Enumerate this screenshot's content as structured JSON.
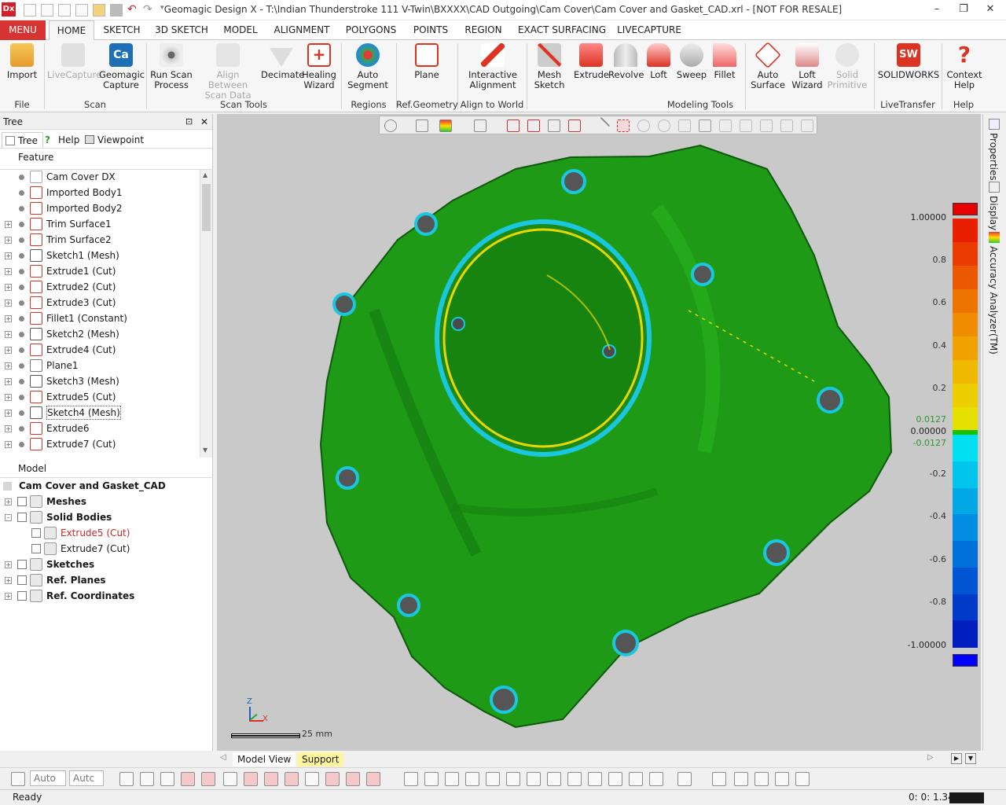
{
  "window": {
    "app_icon": "Dx",
    "title": "Geomagic Design X - T:\\Indian Thunderstroke 111 V-Twin\\BXXXX\\CAD Outgoing\\Cam Cover\\Cam Cover and Gasket_CAD.xrl - [NOT FOR RESALE]",
    "minimize": "–",
    "restore": "❐",
    "close": "✕"
  },
  "menu_tab": "MENU",
  "ribbon_tabs": [
    "HOME",
    "SKETCH",
    "3D SKETCH",
    "MODEL",
    "ALIGNMENT",
    "POLYGONS",
    "POINTS",
    "REGION",
    "EXACT SURFACING",
    "LIVECAPTURE"
  ],
  "ribbon": {
    "import": "Import",
    "livecapture": "LiveCapture",
    "geomagic_capture": "Geomagic Capture",
    "run_scan": "Run Scan Process",
    "align_between": "Align Between Scan Data",
    "decimate": "Decimate",
    "healing": "Healing Wizard",
    "auto_segment": "Auto Segment",
    "plane": "Plane",
    "interactive_alignment": "Interactive Alignment",
    "mesh_sketch": "Mesh Sketch",
    "extrude": "Extrude",
    "revolve": "Revolve",
    "loft": "Loft",
    "sweep": "Sweep",
    "fillet": "Fillet",
    "auto_surface": "Auto Surface",
    "loft_wizard": "Loft Wizard",
    "solid_primitive": "Solid Primitive",
    "solidworks": "SOLIDWORKS",
    "context_help": "Context Help",
    "group_file": "File",
    "group_scan": "Scan",
    "group_scan_tools": "Scan Tools",
    "group_regions": "Regions",
    "group_refgeo": "Ref.Geometry",
    "group_align": "Align to World",
    "group_modeling": "Modeling Tools",
    "group_livetransfer": "LiveTransfer",
    "group_help": "Help"
  },
  "tree": {
    "panel_title": "Tree",
    "pin": "⊡",
    "close": "✕",
    "tabs": [
      "Tree",
      "Help",
      "Viewpoint"
    ],
    "feature_header": "Feature",
    "features": [
      {
        "label": "Cam Cover DX",
        "expandable": false
      },
      {
        "label": "Imported Body1",
        "expandable": false
      },
      {
        "label": "Imported Body2",
        "expandable": false
      },
      {
        "label": "Trim Surface1",
        "expandable": true
      },
      {
        "label": "Trim Surface2",
        "expandable": true
      },
      {
        "label": "Sketch1 (Mesh)",
        "expandable": true
      },
      {
        "label": "Extrude1 (Cut)",
        "expandable": true
      },
      {
        "label": "Extrude2 (Cut)",
        "expandable": true
      },
      {
        "label": "Extrude3 (Cut)",
        "expandable": true
      },
      {
        "label": "Fillet1 (Constant)",
        "expandable": true
      },
      {
        "label": "Sketch2 (Mesh)",
        "expandable": true
      },
      {
        "label": "Extrude4 (Cut)",
        "expandable": true
      },
      {
        "label": "Plane1",
        "expandable": true
      },
      {
        "label": "Sketch3 (Mesh)",
        "expandable": true
      },
      {
        "label": "Extrude5 (Cut)",
        "expandable": true
      },
      {
        "label": "Sketch4 (Mesh)",
        "expandable": true
      },
      {
        "label": "Extrude6",
        "expandable": true
      },
      {
        "label": "Extrude7 (Cut)",
        "expandable": true
      }
    ],
    "model_header": "Model",
    "model_root": "Cam Cover and Gasket_CAD",
    "model_items": [
      {
        "label": "Meshes",
        "indent": 0,
        "expander": "+",
        "bold": true,
        "color": "#1a1a1a"
      },
      {
        "label": "Solid Bodies",
        "indent": 0,
        "expander": "–",
        "bold": true,
        "color": "#1a1a1a"
      },
      {
        "label": "Extrude5 (Cut)",
        "indent": 1,
        "expander": "",
        "bold": false,
        "color": "#c62828"
      },
      {
        "label": "Extrude7 (Cut)",
        "indent": 1,
        "expander": "",
        "bold": false,
        "color": "#1a1a1a"
      },
      {
        "label": "Sketches",
        "indent": 0,
        "expander": "+",
        "bold": true,
        "color": "#1a1a1a"
      },
      {
        "label": "Ref. Planes",
        "indent": 0,
        "expander": "+",
        "bold": true,
        "color": "#1a1a1a"
      },
      {
        "label": "Ref. Coordinates",
        "indent": 0,
        "expander": "+",
        "bold": true,
        "color": "#1a1a1a"
      }
    ]
  },
  "viewport": {
    "scale_label": "25 mm",
    "axis_z": "Z",
    "axis_x": "X",
    "colorbar_labels": [
      "1.00000",
      "0.8",
      "0.6",
      "0.4",
      "0.2",
      "0.0127",
      "0.00000",
      "-0.0127",
      "-0.2",
      "-0.4",
      "-0.6",
      "-0.8",
      "-1.00000"
    ],
    "colorbar_colors": [
      "#e60000",
      "#e81f00",
      "#ea3c00",
      "#ec5800",
      "#ee7400",
      "#ef8c00",
      "#f0a300",
      "#efb900",
      "#edce00",
      "#e6e000",
      "#00e0f0",
      "#00c4ec",
      "#00a8e6",
      "#008ce0",
      "#0070da",
      "#0055d2",
      "#003ac8",
      "#001fbe",
      "#0000ff"
    ],
    "colorbar_mid": "#17c000"
  },
  "dock_tabs": [
    "Properties",
    "Display",
    "Accuracy Analyzer(TM)"
  ],
  "bottom_tabs": [
    "Model View",
    "Support"
  ],
  "bottom_toolbar": {
    "combo1": "Auto",
    "combo2": "Autc"
  },
  "status": {
    "text": "Ready",
    "time": "0: 0: 1.34"
  }
}
